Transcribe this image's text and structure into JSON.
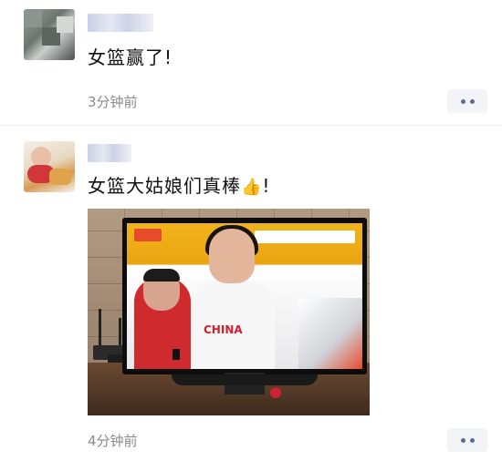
{
  "posts": [
    {
      "comment": "女篮赢了!",
      "time": "3分钟前"
    },
    {
      "comment": "女篮大姑娘们真棒",
      "comment_suffix": "!",
      "emoji": "👍",
      "time": "4分钟前",
      "photo": {
        "brand_on_jersey": "CHINA"
      }
    }
  ],
  "colors": {
    "time_text": "#8a8a8a",
    "more_dots": "#576b95",
    "more_bg": "#f3f4f7"
  },
  "icons": {
    "more": "more-dots-icon",
    "thumbs_up": "thumbs-up-emoji"
  }
}
